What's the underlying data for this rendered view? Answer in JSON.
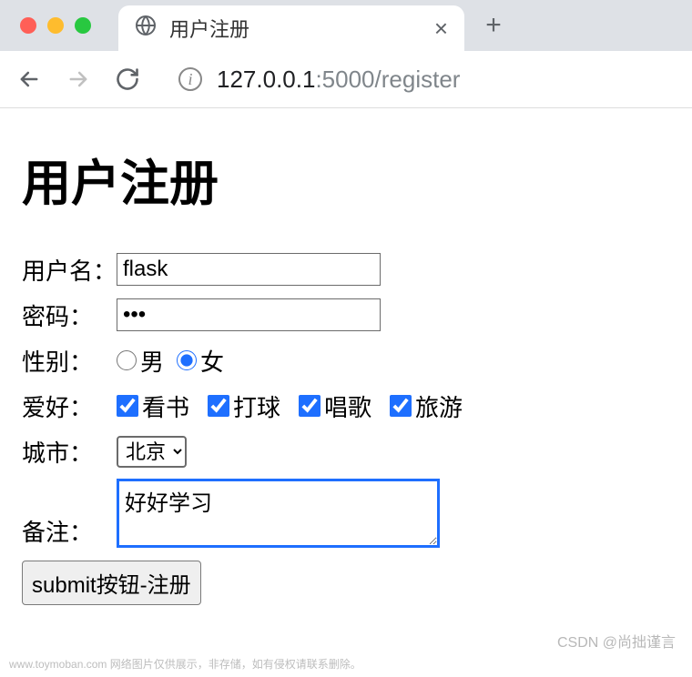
{
  "browser": {
    "tab_title": "用户注册",
    "url_host": "127.0.0.1",
    "url_port": ":5000",
    "url_path": "/register"
  },
  "page": {
    "heading": "用户注册"
  },
  "form": {
    "username": {
      "label": "用户名：",
      "value": "flask"
    },
    "password": {
      "label": "密码：",
      "value": "•••"
    },
    "gender": {
      "label": "性别：",
      "options": {
        "male": "男",
        "female": "女"
      },
      "selected": "female"
    },
    "hobby": {
      "label": "爱好：",
      "options": {
        "read": "看书",
        "ball": "打球",
        "sing": "唱歌",
        "travel": "旅游"
      }
    },
    "city": {
      "label": "城市：",
      "selected": "北京"
    },
    "remark": {
      "label": "备注：",
      "value": "好好学习"
    },
    "submit": "submit按钮-注册"
  },
  "watermark": {
    "bl": "www.toymoban.com  网络图片仅供展示，非存储，如有侵权请联系删除。",
    "br": "CSDN @尚拙谨言"
  }
}
